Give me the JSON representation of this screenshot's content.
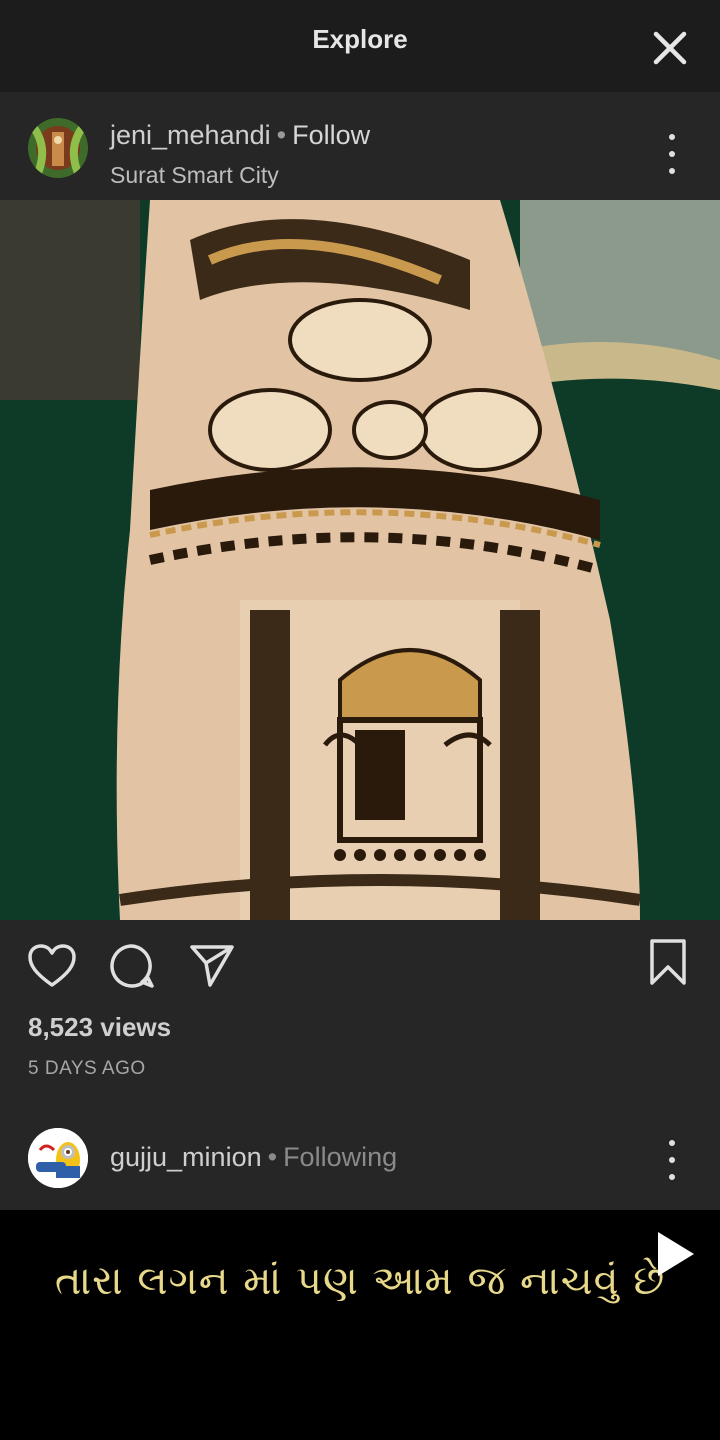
{
  "header": {
    "title": "Explore",
    "close_icon": "close-icon"
  },
  "post": {
    "username": "jeni_mehandi",
    "separator": "•",
    "follow_label": "Follow",
    "location": "Surat Smart City",
    "views": "8,523 views",
    "date": "5 DAYS AGO",
    "icons": [
      "heart-icon",
      "comment-icon",
      "share-icon",
      "bookmark-icon"
    ]
  },
  "next_post": {
    "username": "gujju_minion",
    "separator": "•",
    "follow_state": "Following",
    "caption": "તારા લગન માં પણ આમ જ નાચવું છે"
  },
  "colors": {
    "background": "#262626",
    "caption": "#e8d88a"
  }
}
